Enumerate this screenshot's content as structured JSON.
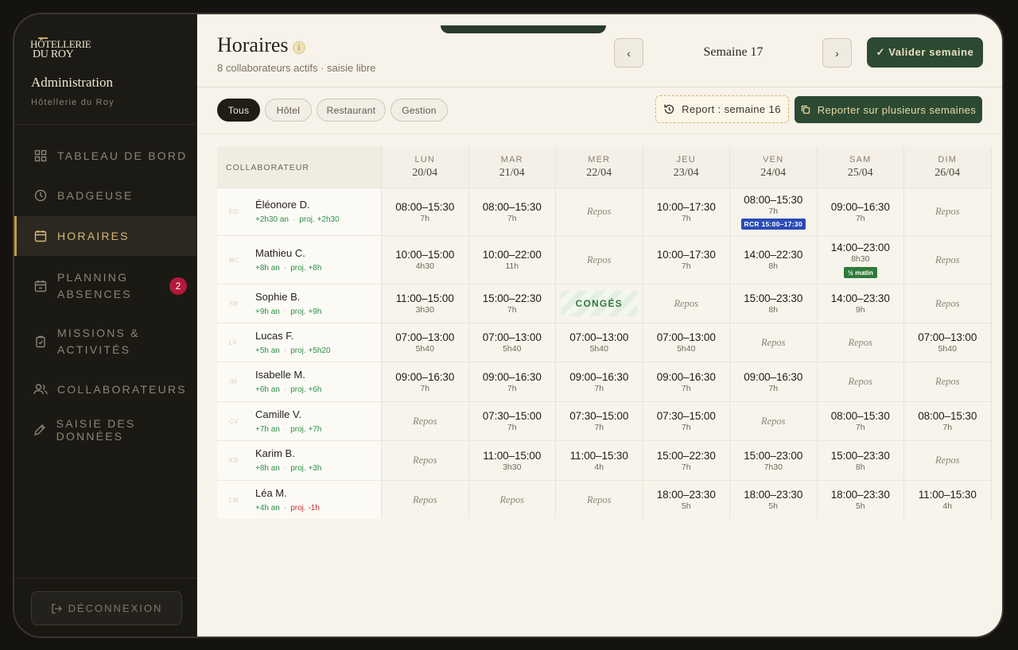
{
  "sidebar": {
    "logo": {
      "line1": "HÔTELLERIE",
      "line2": "DU ROY"
    },
    "title": "Administration",
    "subtitle": "Hôtellerie du Roy",
    "nav": [
      {
        "label": "TABLEAU DE BORD",
        "icon": "grid-icon"
      },
      {
        "label": "BADGEUSE",
        "icon": "clock-icon"
      },
      {
        "label": "HORAIRES",
        "icon": "calendar-icon",
        "active": true
      },
      {
        "label_line1": "PLANNING",
        "label_line2": "ABSENCES",
        "icon": "calendar-check-icon",
        "badge": "2"
      },
      {
        "label_line1": "MISSIONS &",
        "label_line2": "ACTIVITÉS",
        "icon": "clipboard-icon"
      },
      {
        "label": "COLLABORATEURS",
        "icon": "users-icon"
      },
      {
        "label": "SAISIE DES DONNÉES",
        "icon": "pencil-icon"
      }
    ],
    "logout": "DÉCONNEXION"
  },
  "header": {
    "title": "Horaires",
    "subtitle": "8 collaborateurs actifs · saisie libre",
    "week_label": "Semaine 17",
    "prev": "‹",
    "next": "›",
    "validate": "✓ Valider semaine"
  },
  "filters": [
    "Tous",
    "Hôtel",
    "Restaurant",
    "Gestion"
  ],
  "report_label": "Report : semaine 16",
  "multi_report_label": "Reporter sur plusieurs semaines",
  "grid": {
    "col_header": "COLLABORATEUR",
    "days": [
      {
        "name": "LUN",
        "date": "20/04"
      },
      {
        "name": "MAR",
        "date": "21/04"
      },
      {
        "name": "MER",
        "date": "22/04"
      },
      {
        "name": "JEU",
        "date": "23/04"
      },
      {
        "name": "VEN",
        "date": "24/04"
      },
      {
        "name": "SAM",
        "date": "25/04"
      },
      {
        "name": "DIM",
        "date": "26/04"
      }
    ],
    "rows": [
      {
        "name": "Éléonore D.",
        "initials": "ED",
        "an": "+2h30 an",
        "proj": "proj. +2h30",
        "proj_neg": false,
        "cells": [
          {
            "t": "08:00–15:30",
            "d": "7h"
          },
          {
            "t": "08:00–15:30",
            "d": "7h"
          },
          {
            "repos": "Repos"
          },
          {
            "t": "10:00–17:30",
            "d": "7h"
          },
          {
            "t": "08:00–15:30",
            "d": "7h",
            "tag_blue": "RCR 15:00–17:30"
          },
          {
            "t": "09:00–16:30",
            "d": "7h"
          },
          {
            "repos": "Repos"
          }
        ]
      },
      {
        "name": "Mathieu C.",
        "initials": "MC",
        "an": "+8h an",
        "proj": "proj. +8h",
        "proj_neg": false,
        "cells": [
          {
            "t": "10:00–15:00",
            "d": "4h30"
          },
          {
            "t": "10:00–22:00",
            "d": "11h"
          },
          {
            "repos": "Repos"
          },
          {
            "t": "10:00–17:30",
            "d": "7h"
          },
          {
            "t": "14:00–22:30",
            "d": "8h"
          },
          {
            "t": "14:00–23:00",
            "d": "8h30",
            "tag_green": "½ matin"
          },
          {
            "repos": "Repos"
          }
        ]
      },
      {
        "name": "Sophie B.",
        "initials": "SB",
        "an": "+9h an",
        "proj": "proj. +9h",
        "proj_neg": false,
        "cells": [
          {
            "t": "11:00–15:00",
            "d": "3h30"
          },
          {
            "t": "15:00–22:30",
            "d": "7h"
          },
          {
            "conges": "CONGÉS"
          },
          {
            "repos": "Repos"
          },
          {
            "t": "15:00–23:30",
            "d": "8h"
          },
          {
            "t": "14:00–23:30",
            "d": "9h"
          },
          {
            "repos": "Repos"
          }
        ]
      },
      {
        "name": "Lucas F.",
        "initials": "LF",
        "an": "+5h an",
        "proj": "proj. +5h20",
        "proj_neg": false,
        "cells": [
          {
            "t": "07:00–13:00",
            "d": "5h40"
          },
          {
            "t": "07:00–13:00",
            "d": "5h40"
          },
          {
            "t": "07:00–13:00",
            "d": "5h40"
          },
          {
            "t": "07:00–13:00",
            "d": "5h40"
          },
          {
            "repos": "Repos"
          },
          {
            "repos": "Repos"
          },
          {
            "t": "07:00–13:00",
            "d": "5h40"
          }
        ]
      },
      {
        "name": "Isabelle M.",
        "initials": "IM",
        "an": "+6h an",
        "proj": "proj. +6h",
        "proj_neg": false,
        "cells": [
          {
            "t": "09:00–16:30",
            "d": "7h"
          },
          {
            "t": "09:00–16:30",
            "d": "7h"
          },
          {
            "t": "09:00–16:30",
            "d": "7h"
          },
          {
            "t": "09:00–16:30",
            "d": "7h"
          },
          {
            "t": "09:00–16:30",
            "d": "7h"
          },
          {
            "repos": "Repos"
          },
          {
            "repos": "Repos"
          }
        ]
      },
      {
        "name": "Camille V.",
        "initials": "CV",
        "an": "+7h an",
        "proj": "proj. +7h",
        "proj_neg": false,
        "cells": [
          {
            "repos": "Repos"
          },
          {
            "t": "07:30–15:00",
            "d": "7h"
          },
          {
            "t": "07:30–15:00",
            "d": "7h"
          },
          {
            "t": "07:30–15:00",
            "d": "7h"
          },
          {
            "repos": "Repos"
          },
          {
            "t": "08:00–15:30",
            "d": "7h"
          },
          {
            "t": "08:00–15:30",
            "d": "7h"
          }
        ]
      },
      {
        "name": "Karim B.",
        "initials": "KB",
        "an": "+8h an",
        "proj": "proj. +3h",
        "proj_neg": false,
        "cells": [
          {
            "repos": "Repos"
          },
          {
            "t": "11:00–15:00",
            "d": "3h30"
          },
          {
            "t": "11:00–15:30",
            "d": "4h"
          },
          {
            "t": "15:00–22:30",
            "d": "7h"
          },
          {
            "t": "15:00–23:00",
            "d": "7h30"
          },
          {
            "t": "15:00–23:30",
            "d": "8h"
          },
          {
            "repos": "Repos"
          }
        ]
      },
      {
        "name": "Léa M.",
        "initials": "LM",
        "an": "+4h an",
        "proj": "proj. -1h",
        "proj_neg": true,
        "cells": [
          {
            "repos": "Repos"
          },
          {
            "repos": "Repos"
          },
          {
            "repos": "Repos"
          },
          {
            "t": "18:00–23:30",
            "d": "5h"
          },
          {
            "t": "18:00–23:30",
            "d": "5h"
          },
          {
            "t": "18:00–23:30",
            "d": "5h"
          },
          {
            "t": "11:00–15:30",
            "d": "4h"
          }
        ]
      }
    ]
  }
}
